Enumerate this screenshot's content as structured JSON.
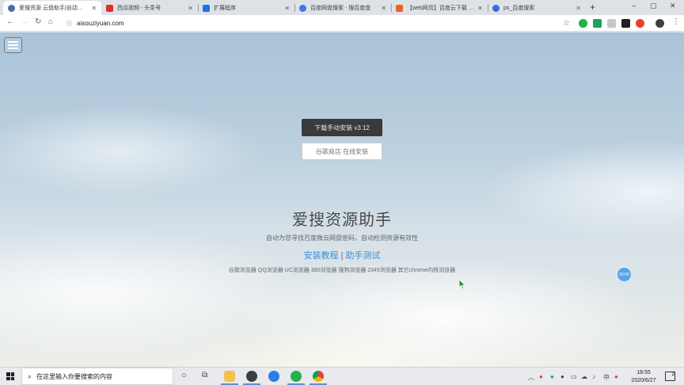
{
  "browser": {
    "tabs": [
      {
        "title": "爱搜资源 云盘助手|自动为您…",
        "favicon_color": "#4a6fa5",
        "active": true
      },
      {
        "title": "西瓜视频 - 头条号",
        "favicon_color": "#e0302d",
        "active": false
      },
      {
        "title": "扩展程序",
        "favicon_color": "#1a73e8",
        "active": false
      },
      {
        "title": "百度网盘搜索 - 搜百度盘",
        "favicon_color": "#3b78e7",
        "active": false
      },
      {
        "title": "【web网页】百度云下载 - 【…",
        "favicon_color": "#e8622c",
        "active": false
      },
      {
        "title": "ps_百度搜索",
        "favicon_color": "#2e6be6",
        "active": false
      }
    ],
    "new_tab": "+",
    "window_controls": {
      "minimize": "–",
      "maximize": "▢",
      "close": "✕"
    },
    "nav": {
      "back": "←",
      "forward": "→",
      "reload": "↻",
      "home": "⌂"
    },
    "address_url": "aisouziyuan.com",
    "extension_colors": [
      "#22b14c",
      "#1aa260",
      "#9aa0a6",
      "#202124",
      "#e8402c"
    ]
  },
  "page": {
    "download_button": "下载手动安装 v3.12",
    "store_button": "谷歌商店 在线安装",
    "title": "爱搜资源助手",
    "subtitle": "自动为您寻找百度微云网盘密码，自动检测资源有效性",
    "link_tutorial": "安装教程",
    "link_separator": "|",
    "link_test": "助手测试",
    "supported_browsers": "谷歌浏览器 QQ浏览器 UC浏览器 360浏览器 搜狗浏览器 2345浏览器 其它chrome内核浏览器",
    "timer": "00:00"
  },
  "taskbar": {
    "search_placeholder": "在这里输入你要搜索的内容",
    "clock_time": "18:55",
    "clock_date": "2020/6/27",
    "notification_count": "2",
    "ime": "中"
  }
}
